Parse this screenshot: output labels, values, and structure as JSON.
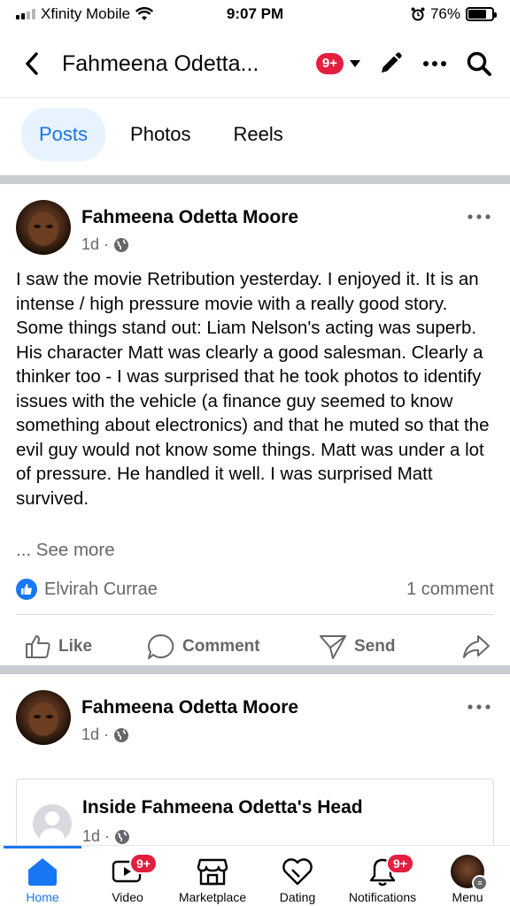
{
  "status_bar": {
    "carrier": "Xfinity Mobile",
    "time": "9:07 PM",
    "battery": "76%",
    "battery_level": 0.76
  },
  "header": {
    "title": "Fahmeena Odetta...",
    "notifications_badge": "9+"
  },
  "tabs": [
    {
      "label": "Posts",
      "active": true
    },
    {
      "label": "Photos",
      "active": false
    },
    {
      "label": "Reels",
      "active": false
    }
  ],
  "post1": {
    "author": "Fahmeena Odetta Moore",
    "time": "1d",
    "separator": "·",
    "text": "I saw the movie Retribution yesterday. I enjoyed it. It is an intense / high pressure movie with a really good story. Some things stand out: Liam Nelson's acting was superb. His character Matt was clearly a good salesman. Clearly a thinker too - I was surprised that he took photos to identify issues with the vehicle (a finance guy seemed to know something about electronics) and that he muted so that the evil guy would not know some things. Matt was under a lot of pressure. He handled it well. I was surprised Matt survived.",
    "see_more": "... See more",
    "reaction_name": "Elvirah Currae",
    "comments": "1 comment",
    "actions": {
      "like": "Like",
      "comment": "Comment",
      "send": "Send"
    }
  },
  "post2": {
    "author": "Fahmeena Odetta Moore",
    "time": "1d",
    "separator": "·",
    "shared_title": "Inside Fahmeena Odetta's Head",
    "shared_time": "1d"
  },
  "bottom_nav": {
    "home": "Home",
    "video": "Video",
    "video_badge": "9+",
    "marketplace": "Marketplace",
    "dating": "Dating",
    "notifications": "Notifications",
    "notifications_badge": "9+",
    "menu": "Menu"
  },
  "colors": {
    "accent": "#1877f2",
    "badge": "#e41e3f",
    "secondary_text": "#65676b"
  }
}
